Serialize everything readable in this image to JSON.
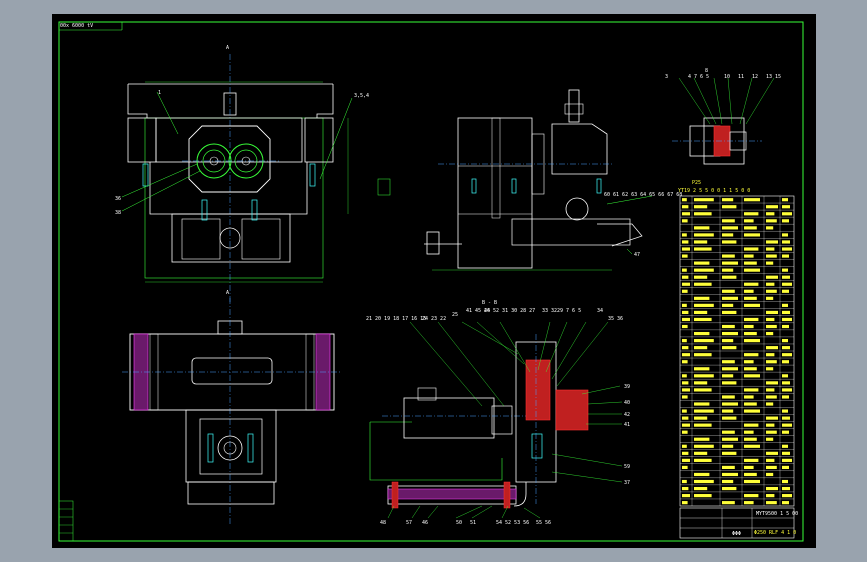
{
  "drawing": {
    "header_code": "00x 6000 tV",
    "section_top": "A",
    "section_mid": "A",
    "section_label": "B - B",
    "assembly_label_top_left": "3,5,4",
    "leader_left": [
      "36",
      "38"
    ],
    "top_leaders": [
      "21 20 19 18 17 16 15",
      "24 23 22",
      "25",
      "41 45 44",
      "26 52 31 30 28 27",
      "33 32",
      "29 7 6 5",
      "34",
      "35 36"
    ],
    "right_leaders": [
      "39",
      "40",
      "42",
      "41",
      "59",
      "37"
    ],
    "bottom_leaders": [
      "48",
      "57",
      "46",
      "50",
      "51",
      "54 52 53 56",
      "55 56"
    ],
    "detail_top_labels": [
      "3",
      "4 7 6 5",
      "8",
      "10",
      "11",
      "12",
      "13 15"
    ],
    "mid_view_leader": "60 61 62 63 64 65 66 67 68",
    "mid_view_leader2": "47",
    "parts_table_title": "YT19 2 5 5 0 0 1 1 5 0 0",
    "parts_table_note": "P25",
    "title_block_code": "MYT9500 1 5 00",
    "title_block_name": "Φ250 RLF 4 1 0",
    "title_block_sheet": "ΦΦΦ"
  },
  "colors": {
    "background": "#99a3ae",
    "sheet": "#000000",
    "line_white": "#ffffff",
    "line_green": "#39ff39",
    "line_yellow": "#ffff3a",
    "line_blue": "#5080ff",
    "line_magenta": "#ff40ff",
    "line_red": "#ff3030",
    "line_cyan": "#40ffff"
  }
}
